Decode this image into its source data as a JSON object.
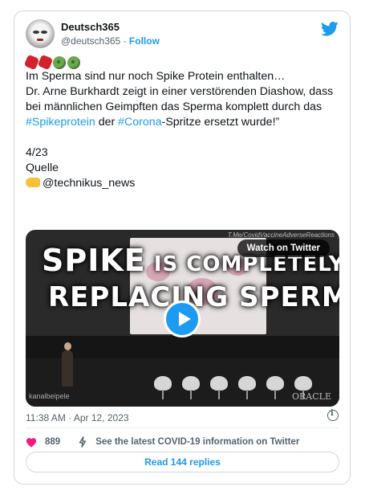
{
  "account": {
    "name": "Deutsch365",
    "handle": "@deutsch365",
    "separator": "·",
    "follow_label": "Follow"
  },
  "tweet": {
    "emojis": [
      "stop-sign-icon",
      "stop-sign-icon",
      "microbe-icon",
      "microbe-icon"
    ],
    "line1": "Im Sperma sind nur noch Spike Protein enthalten…",
    "line2_pre": "Dr. Arne Burkhardt zeigt in einer verstörenden Diashow, dass bei männlichen Geimpften das Sperma komplett durch das ",
    "hashtag1": "#Spikeprotein",
    "line2_mid": " der ",
    "hashtag2": "#Corona",
    "line2_post": "-Spritze ersetzt wurde!”",
    "count": "4/23",
    "source_label": "Quelle",
    "source_handle": "@technikus_news"
  },
  "media": {
    "headline_line1_big": "SPIKE",
    "headline_line1_rest": " IS COMPLETELY",
    "headline_line2": "REPLACING SPERM",
    "credit": "T.Me/CovidVaccineAdverseReactions",
    "watch_label": "Watch on Twitter",
    "watermark": "kanalbeipele",
    "stage_logo": "ORACLE"
  },
  "meta": {
    "time": "11:38 AM",
    "separator": "·",
    "date": "Apr 12, 2023"
  },
  "actions": {
    "likes": "889",
    "covid_info": "See the latest COVID-19 information on Twitter",
    "replies_label": "Read 144 replies"
  },
  "colors": {
    "brand": "#1d9bf0",
    "like": "#f91880",
    "text": "#0f1419",
    "muted": "#536471"
  }
}
